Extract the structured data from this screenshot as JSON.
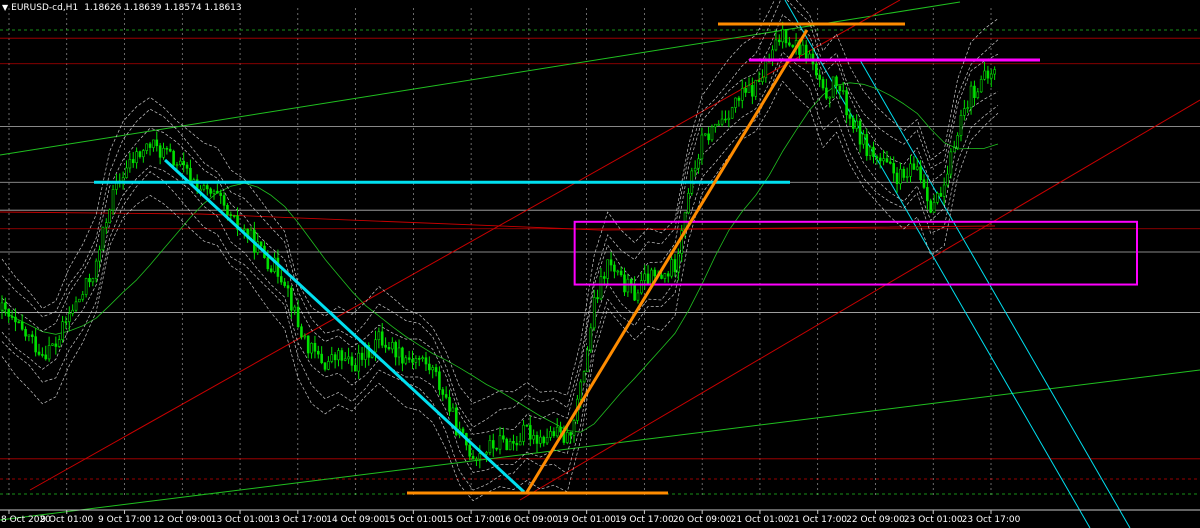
{
  "header": {
    "symbol": "EURUSD-cd,H1",
    "ohlc": "1.18626 1.18639 1.18574 1.18613"
  },
  "colors": {
    "background": "#000000",
    "grid": "#c8c8c8",
    "candle": "#00e000",
    "cyan": "#00e0f0",
    "orange": "#ff8c00",
    "magenta": "#ff00ff",
    "red": "#c80000",
    "green": "#20c020",
    "band": "#c8c8c8"
  },
  "chart_data": {
    "type": "line",
    "x_ticks": [
      "8 Oct 2020",
      "9 Oct 01:00",
      "9 Oct 17:00",
      "12 Oct 09:00",
      "13 Oct 01:00",
      "13 Oct 17:00",
      "14 Oct 09:00",
      "15 Oct 01:00",
      "15 Oct 17:00",
      "16 Oct 09:00",
      "19 Oct 01:00",
      "19 Oct 17:00",
      "20 Oct 09:00",
      "21 Oct 01:00",
      "21 Oct 17:00",
      "22 Oct 09:00",
      "23 Oct 01:00",
      "23 Oct 17:00"
    ],
    "ylim": [
      1.168,
      1.189
    ],
    "series": [
      {
        "values": [
          1.176,
          1.1753,
          1.1748,
          1.1742,
          1.1745,
          1.1758,
          1.1767,
          1.1779,
          1.1806,
          1.1819,
          1.1826,
          1.1831,
          1.1828,
          1.1823,
          1.1817,
          1.1811,
          1.1808,
          1.1798,
          1.1794,
          1.1787,
          1.178,
          1.1774,
          1.1753,
          1.1742,
          1.1737,
          1.174,
          1.1736,
          1.1741,
          1.1748,
          1.1744,
          1.174,
          1.1739,
          1.1734,
          1.1722,
          1.1706,
          1.1698,
          1.17,
          1.1703,
          1.1703,
          1.1708,
          1.1705,
          1.1707,
          1.1704,
          1.1726,
          1.1762,
          1.178,
          1.1772,
          1.1767,
          1.1774,
          1.1773,
          1.178,
          1.1812,
          1.1832,
          1.1839,
          1.1846,
          1.1852,
          1.1856,
          1.1867,
          1.188,
          1.1874,
          1.1869,
          1.1852,
          1.1858,
          1.1843,
          1.1832,
          1.1825,
          1.182,
          1.1816,
          1.1822,
          1.1806,
          1.181,
          1.1839,
          1.1854,
          1.1859,
          1.1863
        ]
      }
    ],
    "levels": [
      1.1877,
      1.1866,
      1.1839,
      1.1815,
      1.1803,
      1.1795,
      1.1785,
      1.1759,
      1.1696
    ],
    "zones": [
      {
        "x_range": [
          "19 Oct 01:00",
          "23 Oct 17:00"
        ],
        "y_range": [
          1.1771,
          1.1798
        ]
      }
    ]
  }
}
